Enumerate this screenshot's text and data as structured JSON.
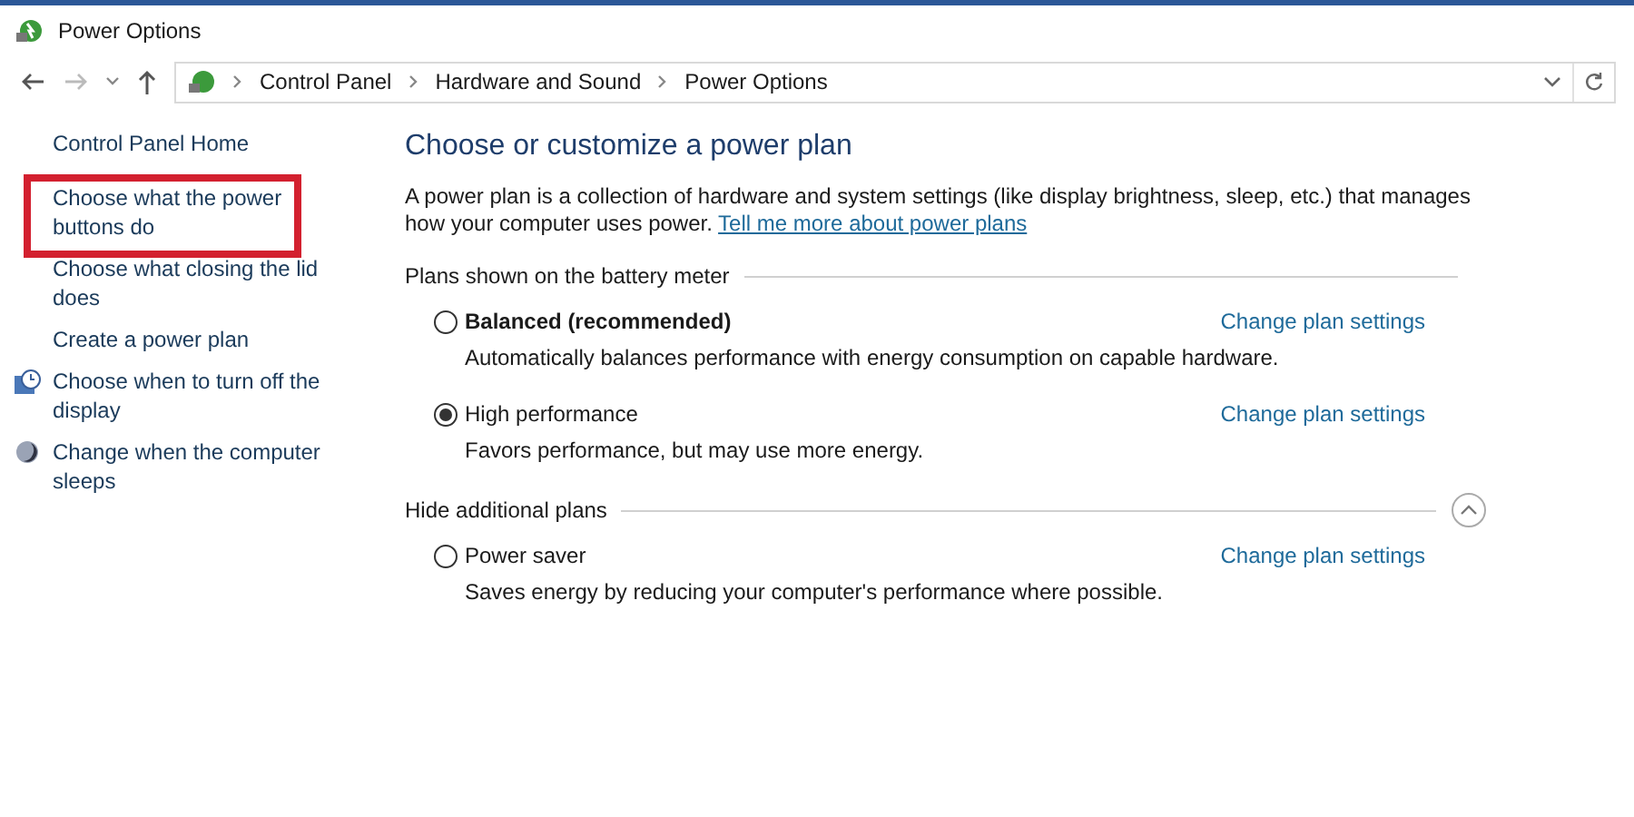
{
  "window": {
    "title": "Power Options"
  },
  "address_bar": {
    "breadcrumbs": [
      "Control Panel",
      "Hardware and Sound",
      "Power Options"
    ]
  },
  "sidebar": {
    "items": [
      {
        "label": "Control Panel Home",
        "kind": "plain",
        "highlighted": false
      },
      {
        "label": "Choose what the power buttons do",
        "kind": "plain",
        "highlighted": true
      },
      {
        "label": "Choose what closing the lid does",
        "kind": "plain",
        "highlighted": false
      },
      {
        "label": "Create a power plan",
        "kind": "plain",
        "highlighted": false
      },
      {
        "label": "Choose when to turn off the display",
        "kind": "display",
        "highlighted": false
      },
      {
        "label": "Change when the computer sleeps",
        "kind": "sleep",
        "highlighted": false
      }
    ]
  },
  "main": {
    "heading": "Choose or customize a power plan",
    "description": "A power plan is a collection of hardware and system settings (like display brightness, sleep, etc.) that manages how your computer uses power.",
    "learn_more_link": "Tell me more about power plans",
    "groups": [
      {
        "title": "Plans shown on the battery meter",
        "plans": [
          {
            "name": "Balanced (recommended)",
            "bold": true,
            "selected": false,
            "description": "Automatically balances performance with energy consumption on capable hardware.",
            "link": "Change plan settings"
          },
          {
            "name": "High performance",
            "bold": false,
            "selected": true,
            "description": "Favors performance, but may use more energy.",
            "link": "Change plan settings"
          }
        ]
      },
      {
        "title": "Hide additional plans",
        "collapse_button": true,
        "plans": [
          {
            "name": "Power saver",
            "bold": false,
            "selected": false,
            "description": "Saves energy by reducing your computer's performance where possible.",
            "link": "Change plan settings"
          }
        ]
      }
    ]
  }
}
